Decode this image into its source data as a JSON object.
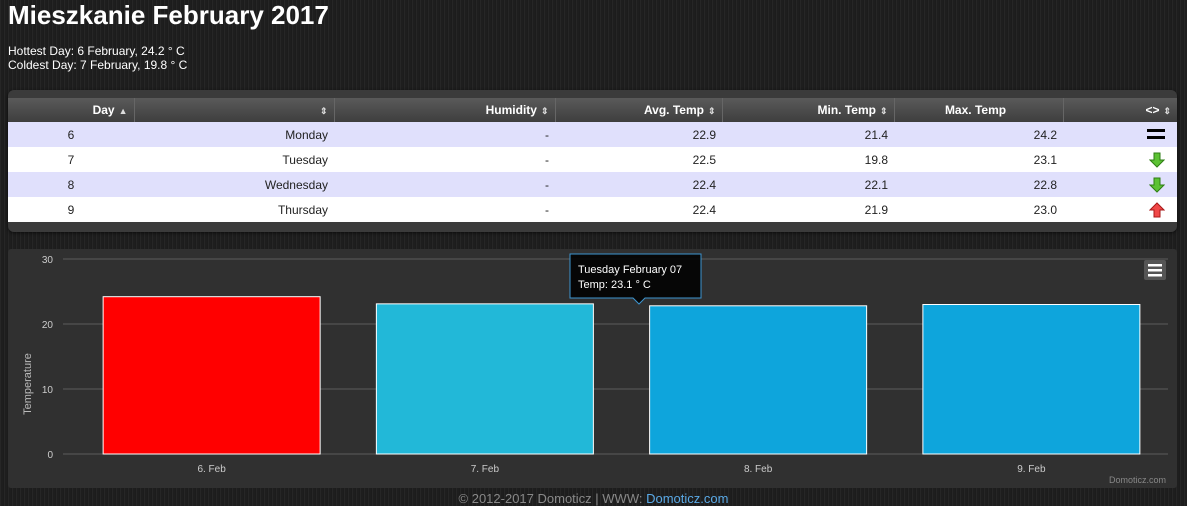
{
  "page": {
    "title": "Mieszkanie February 2017",
    "hottest": "Hottest Day: 6 February, 24.2 ° C",
    "coldest": "Coldest Day: 7 February, 19.8 ° C"
  },
  "table": {
    "headers": [
      "Day",
      "",
      "Humidity",
      "Avg. Temp",
      "Min. Temp",
      "Max. Temp",
      "<>"
    ],
    "rows": [
      {
        "day": "6",
        "weekday": "Monday",
        "humidity": "-",
        "avg": "22.9",
        "min": "21.4",
        "max": "24.2",
        "trend": "equal-icon"
      },
      {
        "day": "7",
        "weekday": "Tuesday",
        "humidity": "-",
        "avg": "22.5",
        "min": "19.8",
        "max": "23.1",
        "trend": "down-arrow-icon"
      },
      {
        "day": "8",
        "weekday": "Wednesday",
        "humidity": "-",
        "avg": "22.4",
        "min": "22.1",
        "max": "22.8",
        "trend": "down-arrow-icon"
      },
      {
        "day": "9",
        "weekday": "Thursday",
        "humidity": "-",
        "avg": "22.4",
        "min": "21.9",
        "max": "23.0",
        "trend": "up-arrow-icon"
      }
    ]
  },
  "chart_data": {
    "type": "bar",
    "categories": [
      "6. Feb",
      "7. Feb",
      "8. Feb",
      "9. Feb"
    ],
    "values": [
      24.2,
      23.1,
      22.8,
      23.0
    ],
    "bar_colors": [
      "#ff0000",
      "#22b8d8",
      "#0ea5dc",
      "#0ea5dc"
    ],
    "title": "",
    "xlabel": "",
    "ylabel": "Temperature",
    "ylim": [
      0,
      30
    ],
    "yticks": [
      "0",
      "10",
      "20",
      "30"
    ],
    "grid": true,
    "tooltip": {
      "title": "Tuesday February 07",
      "text": "Temp: 23.1 ° C"
    },
    "credit": "Domoticz.com"
  },
  "footer": {
    "text": "© 2012-2017 Domoticz | WWW: ",
    "link": "Domoticz.com"
  }
}
